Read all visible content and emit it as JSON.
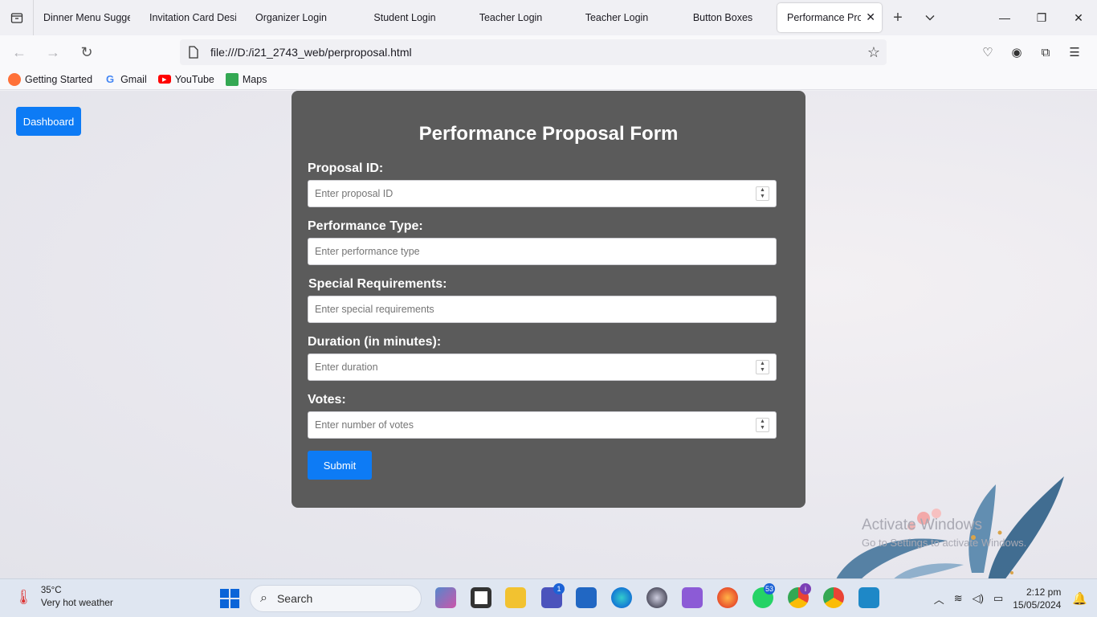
{
  "browser": {
    "tabs": [
      {
        "label": "Dinner Menu Sugges"
      },
      {
        "label": "Invitation Card Desig"
      },
      {
        "label": "Organizer Login"
      },
      {
        "label": "Student Login"
      },
      {
        "label": "Teacher Login"
      },
      {
        "label": "Teacher Login"
      },
      {
        "label": "Button Boxes"
      },
      {
        "label": "Performance Prop"
      }
    ],
    "url": "file:///D:/i21_2743_web/perproposal.html",
    "bookmarks": [
      {
        "label": "Getting Started",
        "icon": "firefox-icon"
      },
      {
        "label": "Gmail",
        "icon": "google-icon"
      },
      {
        "label": "YouTube",
        "icon": "youtube-icon"
      },
      {
        "label": "Maps",
        "icon": "maps-icon"
      }
    ]
  },
  "page": {
    "dashboard_label": "Dashboard",
    "form": {
      "title": "Performance Proposal Form",
      "fields": [
        {
          "label": "Proposal ID:",
          "placeholder": "Enter proposal ID",
          "type": "number"
        },
        {
          "label": "Performance Type:",
          "placeholder": "Enter performance type",
          "type": "text"
        },
        {
          "label": "Special Requirements:",
          "placeholder": "Enter special requirements",
          "type": "text"
        },
        {
          "label": "Duration (in minutes):",
          "placeholder": "Enter duration",
          "type": "number"
        },
        {
          "label": "Votes:",
          "placeholder": "Enter number of votes",
          "type": "number"
        }
      ],
      "submit_label": "Submit"
    },
    "watermark": {
      "line1": "Activate Windows",
      "line2": "Go to Settings to activate Windows."
    }
  },
  "taskbar": {
    "weather_temp": "35°C",
    "weather_desc": "Very hot weather",
    "search_label": "Search",
    "teams_badge": "1",
    "whatsapp_badge": "53",
    "chrome_badge": "i",
    "time": "2:12 pm",
    "date": "15/05/2024"
  },
  "colors": {
    "accent": "#0d7bf5",
    "form_bg": "#5b5b5b"
  }
}
